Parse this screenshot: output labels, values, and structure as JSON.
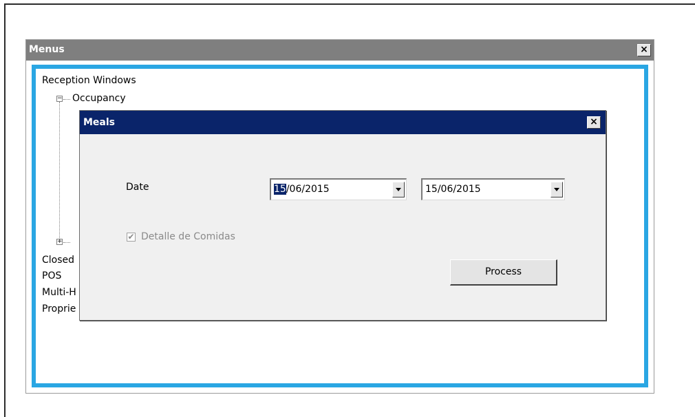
{
  "menus_window": {
    "title": "Menus",
    "close_glyph": "×",
    "tree": {
      "root_label": "Reception Windows",
      "expanded_node": {
        "label": "Occupancy",
        "toggle_glyph": "−"
      },
      "collapsed_node": {
        "toggle_glyph": "+"
      },
      "items": [
        "Closed",
        "POS",
        "Multi-H",
        "Proprie"
      ]
    },
    "accent_color": "#2aa6e3"
  },
  "meals_dialog": {
    "title": "Meals",
    "close_glyph": "×",
    "date_label": "Date",
    "date_from": {
      "selected_part": "15",
      "rest": "/06/2015"
    },
    "date_to": {
      "value": "15/06/2015"
    },
    "checkbox": {
      "label": "Detalle de Comidas",
      "checked": true,
      "disabled": true,
      "glyph": "✔"
    },
    "process_label": "Process",
    "titlebar_color": "#0a246a"
  }
}
